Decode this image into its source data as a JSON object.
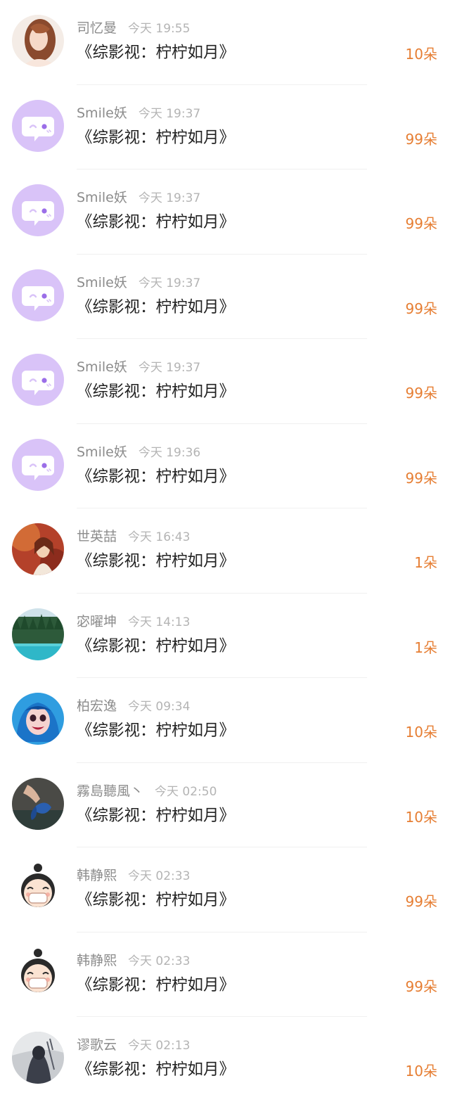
{
  "gift_log": {
    "items": [
      {
        "user": "司忆曼",
        "time": "今天 19:55",
        "book": "《综影视：柠柠如月》",
        "amount": "10朵",
        "avatar": "photo-woman-portrait"
      },
      {
        "user": "Smile妖",
        "time": "今天 19:37",
        "book": "《综影视：柠柠如月》",
        "amount": "99朵",
        "avatar": "default-chat-bubble"
      },
      {
        "user": "Smile妖",
        "time": "今天 19:37",
        "book": "《综影视：柠柠如月》",
        "amount": "99朵",
        "avatar": "default-chat-bubble"
      },
      {
        "user": "Smile妖",
        "time": "今天 19:37",
        "book": "《综影视：柠柠如月》",
        "amount": "99朵",
        "avatar": "default-chat-bubble"
      },
      {
        "user": "Smile妖",
        "time": "今天 19:37",
        "book": "《综影视：柠柠如月》",
        "amount": "99朵",
        "avatar": "default-chat-bubble"
      },
      {
        "user": "Smile妖",
        "time": "今天 19:36",
        "book": "《综影视：柠柠如月》",
        "amount": "99朵",
        "avatar": "default-chat-bubble"
      },
      {
        "user": "世英喆",
        "time": "今天 16:43",
        "book": "《综影视：柠柠如月》",
        "amount": "1朵",
        "avatar": "photo-autumn-woman"
      },
      {
        "user": "宓曜坤",
        "time": "今天 14:13",
        "book": "《综影视：柠柠如月》",
        "amount": "1朵",
        "avatar": "photo-forest-lake"
      },
      {
        "user": "柏宏逸",
        "time": "今天 09:34",
        "book": "《综影视：柠柠如月》",
        "amount": "10朵",
        "avatar": "cartoon-blue-hair-girl"
      },
      {
        "user": "霧島聽風丶",
        "time": "今天 02:50",
        "book": "《综影视：柠柠如月》",
        "amount": "10朵",
        "avatar": "photo-hand-butterfly"
      },
      {
        "user": "韩静熙",
        "time": "今天 02:33",
        "book": "《综影视：柠柠如月》",
        "amount": "99朵",
        "avatar": "cartoon-bun-girl-mask"
      },
      {
        "user": "韩静熙",
        "time": "今天 02:33",
        "book": "《综影视：柠柠如月》",
        "amount": "99朵",
        "avatar": "cartoon-bun-girl-mask"
      },
      {
        "user": "谬歌云",
        "time": "今天 02:13",
        "book": "《综影视：柠柠如月》",
        "amount": "10朵",
        "avatar": "anime-dark-figure"
      }
    ]
  },
  "colors": {
    "amount": "#e67e33",
    "username": "#8c8c8c",
    "timestamp": "#b4b4b4",
    "title": "#222222",
    "default_avatar_bg": "#d9c3f8",
    "default_avatar_accent": "#9b6ee8"
  }
}
